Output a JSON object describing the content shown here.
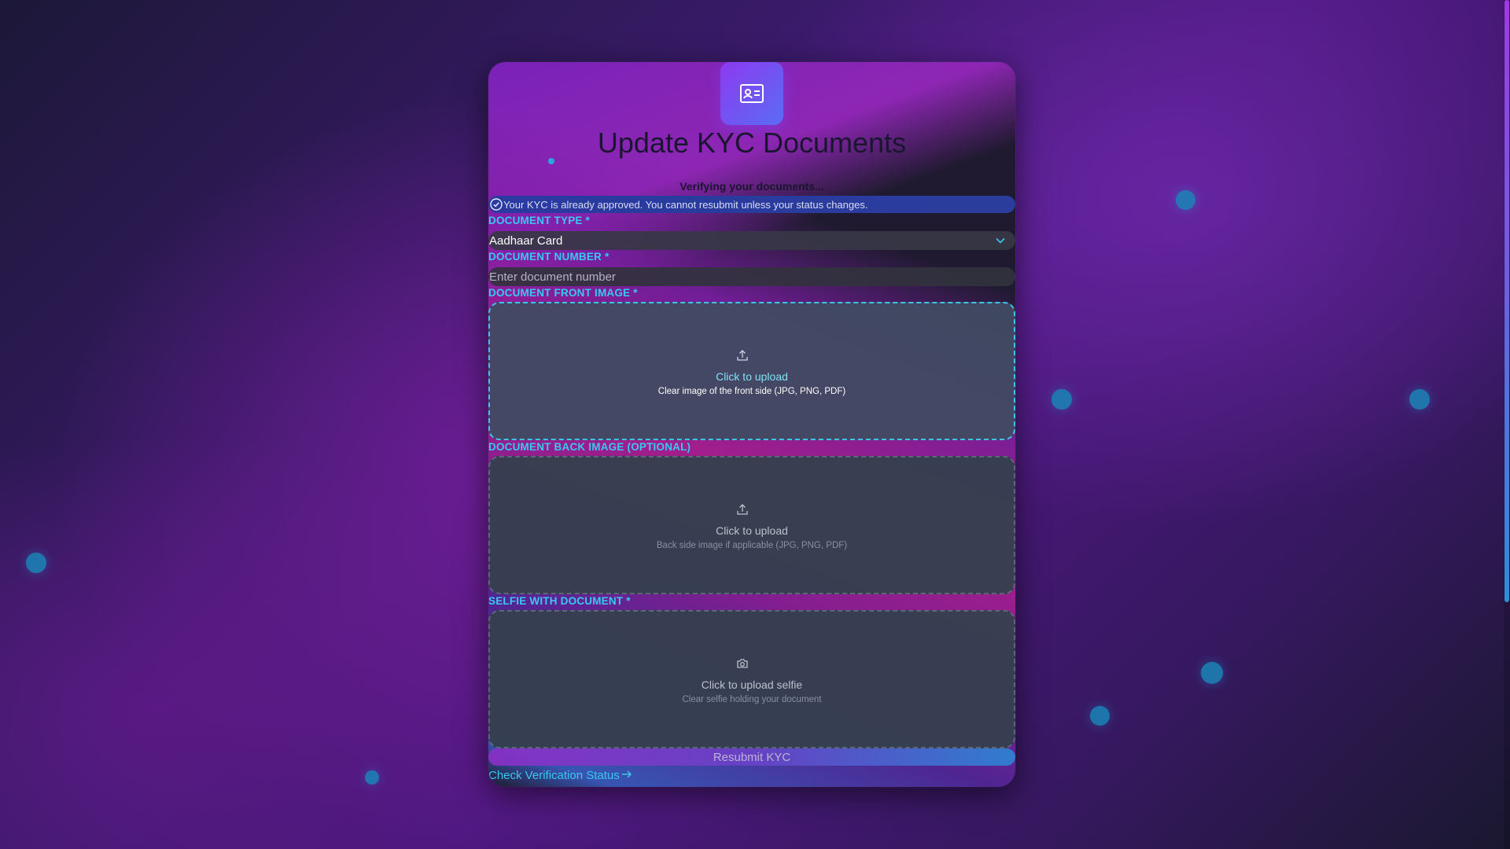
{
  "header": {
    "logo_icon": "id-card-icon",
    "title": "Update KYC Documents",
    "status_text": "Verifying your documents..."
  },
  "banner": {
    "icon": "check-circle-icon",
    "message": "Your KYC is already approved. You cannot resubmit unless your status changes."
  },
  "form": {
    "document_type": {
      "label": "DOCUMENT TYPE *",
      "selected": "Aadhaar Card",
      "icon": "chevron-down-icon"
    },
    "document_number": {
      "label": "DOCUMENT NUMBER *",
      "value": "",
      "placeholder": "Enter document number"
    },
    "front_image": {
      "label": "DOCUMENT FRONT IMAGE *",
      "icon": "upload-icon",
      "main_text": "Click to upload",
      "sub_text": "Clear image of the front side (JPG, PNG, PDF)"
    },
    "back_image": {
      "label": "DOCUMENT BACK IMAGE (OPTIONAL)",
      "icon": "upload-icon",
      "main_text": "Click to upload",
      "sub_text": "Back side image if applicable (JPG, PNG, PDF)"
    },
    "selfie": {
      "label": "SELFIE WITH DOCUMENT *",
      "icon": "camera-icon",
      "main_text": "Click to upload selfie",
      "sub_text": "Clear selfie holding your document"
    },
    "submit_label": "Resubmit KYC"
  },
  "footer": {
    "link_text": "Check Verification Status",
    "link_icon": "arrow-right-icon"
  },
  "colors": {
    "accent_cyan": "#37c9f0",
    "accent_purple": "#8c3af0",
    "banner_blue": "#2a3aa0"
  }
}
